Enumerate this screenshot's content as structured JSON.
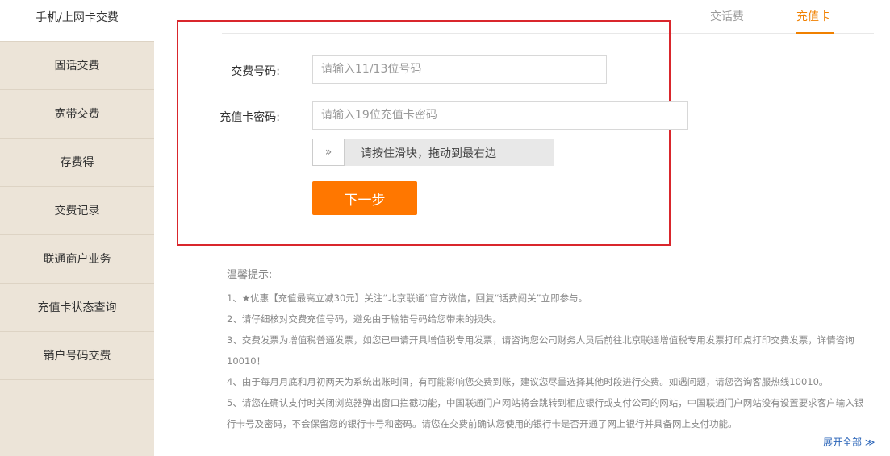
{
  "sidebar": {
    "items": [
      {
        "label": "手机/上网卡交费"
      },
      {
        "label": "固话交费"
      },
      {
        "label": "宽带交费"
      },
      {
        "label": "存费得"
      },
      {
        "label": "交费记录"
      },
      {
        "label": "联通商户业务"
      },
      {
        "label": "充值卡状态查询"
      },
      {
        "label": "销户号码交费"
      }
    ]
  },
  "tabs": [
    {
      "label": "交话费"
    },
    {
      "label": "充值卡"
    }
  ],
  "form": {
    "phone_label": "交费号码:",
    "phone_placeholder": "请输入11/13位号码",
    "card_label": "充值卡密码:",
    "card_placeholder": "请输入19位充值卡密码",
    "slider_handle": "»",
    "slider_text": "请按住滑块，拖动到最右边",
    "next_button": "下一步"
  },
  "tips": {
    "title": "温馨提示:",
    "items": [
      "1、★优惠【充值最高立减30元】关注“北京联通”官方微信，回复“话费闯关”立即参与。",
      "2、请仔细核对交费充值号码，避免由于输错号码给您带来的损失。",
      "3、交费发票为增值税普通发票，如您已申请开具增值税专用发票，请咨询您公司财务人员后前往北京联通增值税专用发票打印点打印交费发票，详情咨询10010！",
      "4、由于每月月底和月初两天为系统出账时间，有可能影响您交费到账，建议您尽量选择其他时段进行交费。如遇问题，请您咨询客服热线10010。",
      "5、请您在确认支付时关闭浏览器弹出窗口拦截功能，中国联通门户网站将会跳转到相应银行或支付公司的网站，中国联通门户网站没有设置要求客户输入银行卡号及密码，不会保留您的银行卡号和密码。请您在交费前确认您使用的银行卡是否开通了网上银行并具备网上支付功能。"
    ],
    "expand_link": "展开全部 ≫"
  },
  "colors": {
    "accent": "#ff7700",
    "tab_active": "#f08000",
    "highlight_frame": "#d9262c",
    "sidebar_bg": "#ece4d8",
    "link": "#2a64b8"
  }
}
